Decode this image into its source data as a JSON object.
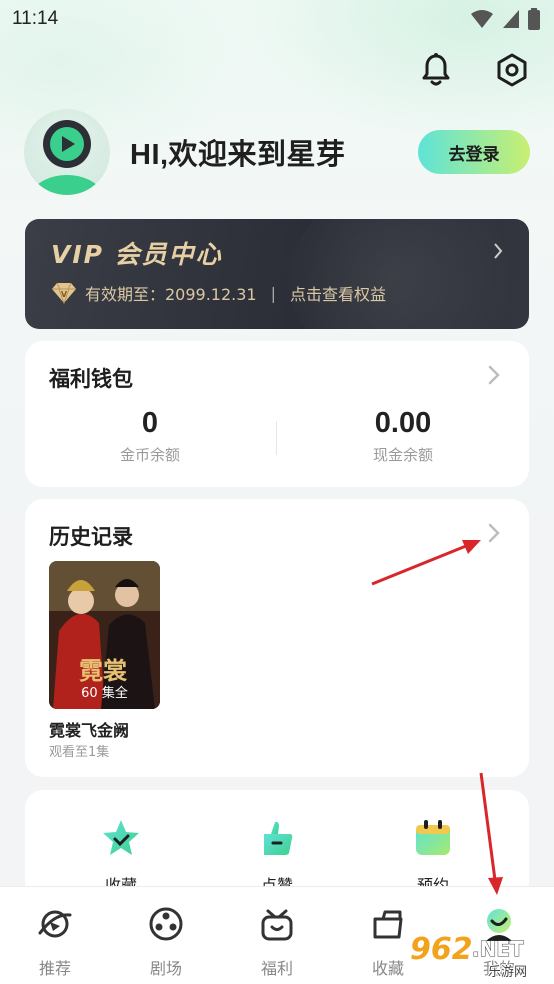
{
  "status_bar": {
    "time": "11:14"
  },
  "profile": {
    "greeting": "HI,欢迎来到星芽",
    "login_button": "去登录"
  },
  "vip": {
    "title": "VIP 会员中心",
    "validity": "有效期至：2099.12.31",
    "separator": "|",
    "benefits_link": "点击查看权益"
  },
  "wallet": {
    "title": "福利钱包",
    "coins_value": "0",
    "coins_label": "金币余额",
    "cash_value": "0.00",
    "cash_label": "现金余额"
  },
  "history": {
    "title": "历史记录",
    "items": [
      {
        "poster_text": "霓裳",
        "episodes": "60 集全",
        "name": "霓裳飞金阙",
        "progress": "观看至1集"
      }
    ]
  },
  "quick_actions": [
    {
      "label": "收藏",
      "icon": "star-icon"
    },
    {
      "label": "点赞",
      "icon": "thumbs-up-icon"
    },
    {
      "label": "预约",
      "icon": "calendar-icon"
    }
  ],
  "tabbar": [
    {
      "label": "推荐",
      "icon": "planet-icon"
    },
    {
      "label": "剧场",
      "icon": "film-reel-icon"
    },
    {
      "label": "福利",
      "icon": "gift-icon"
    },
    {
      "label": "收藏",
      "icon": "folder-icon"
    },
    {
      "label": "我的",
      "icon": "profile-icon"
    }
  ],
  "watermark": {
    "brand": "962",
    "suffix": ".NET",
    "sub": "乐游网"
  },
  "colors": {
    "accent_start": "#5ee3d8",
    "accent_end": "#c8ef72",
    "vip_bg": "#2b2e36",
    "vip_gold": "#e7d0a4",
    "annotation_red": "#d9262b"
  }
}
